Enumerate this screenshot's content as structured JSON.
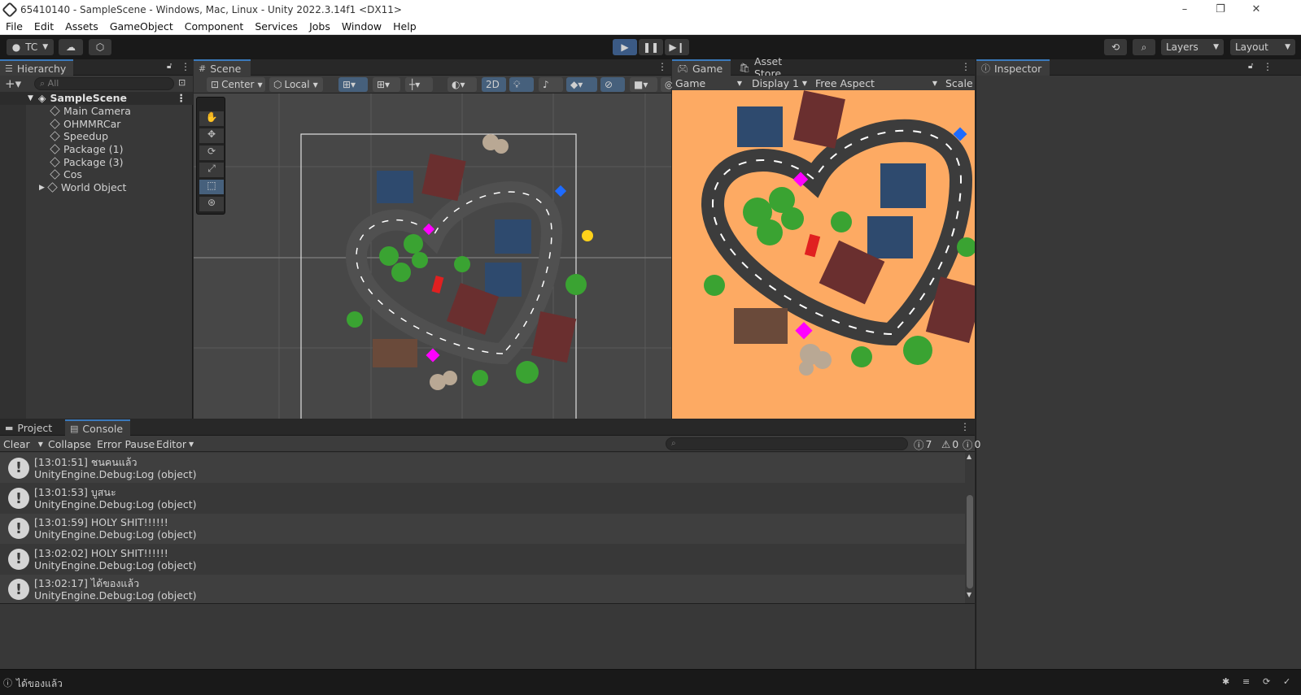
{
  "window": {
    "title": "65410140 - SampleScene - Windows, Mac, Linux - Unity 2022.3.14f1 <DX11>",
    "controls": [
      "–",
      "❐",
      "✕"
    ]
  },
  "menu": [
    "File",
    "Edit",
    "Assets",
    "GameObject",
    "Component",
    "Services",
    "Jobs",
    "Window",
    "Help"
  ],
  "toolbar": {
    "account": "TC",
    "layers": "Layers",
    "layout": "Layout"
  },
  "hierarchy": {
    "tab": "Hierarchy",
    "search_placeholder": "All",
    "scene": "SampleScene",
    "items": [
      "Main Camera",
      "OHMMRCar",
      "Speedup",
      "Package (1)",
      "Package (3)",
      "Cos",
      "World Object"
    ]
  },
  "scene": {
    "tab": "Scene",
    "pivot": "Center",
    "space": "Local",
    "mode2d": "2D"
  },
  "game": {
    "tab": "Game",
    "store_tab": "Asset Store",
    "mode": "Game",
    "display": "Display 1",
    "aspect": "Free Aspect",
    "scale": "Scale"
  },
  "inspector": {
    "tab": "Inspector"
  },
  "console": {
    "tabs": [
      "Project",
      "Console"
    ],
    "clear": "Clear",
    "collapse": "Collapse",
    "error_pause": "Error Pause",
    "editor": "Editor",
    "counts": {
      "logs": "7",
      "warnings": "0",
      "errors": "0"
    },
    "entries": [
      {
        "line1": "[13:01:51] ชนคนแล้ว",
        "line2": "UnityEngine.Debug:Log (object)"
      },
      {
        "line1": "[13:01:53] บูสนะ",
        "line2": "UnityEngine.Debug:Log (object)"
      },
      {
        "line1": "[13:01:59] HOLY SHIT!!!!!!",
        "line2": "UnityEngine.Debug:Log (object)"
      },
      {
        "line1": "[13:02:02] HOLY SHIT!!!!!!",
        "line2": "UnityEngine.Debug:Log (object)"
      },
      {
        "line1": "[13:02:17] ได้ของแล้ว",
        "line2": "UnityEngine.Debug:Log (object)"
      }
    ]
  },
  "status": {
    "last_log": "ได้ของแล้ว"
  },
  "colors": {
    "accent": "#3a79bb",
    "play": "#3b5a85",
    "game_bg": "#fdaa63"
  }
}
